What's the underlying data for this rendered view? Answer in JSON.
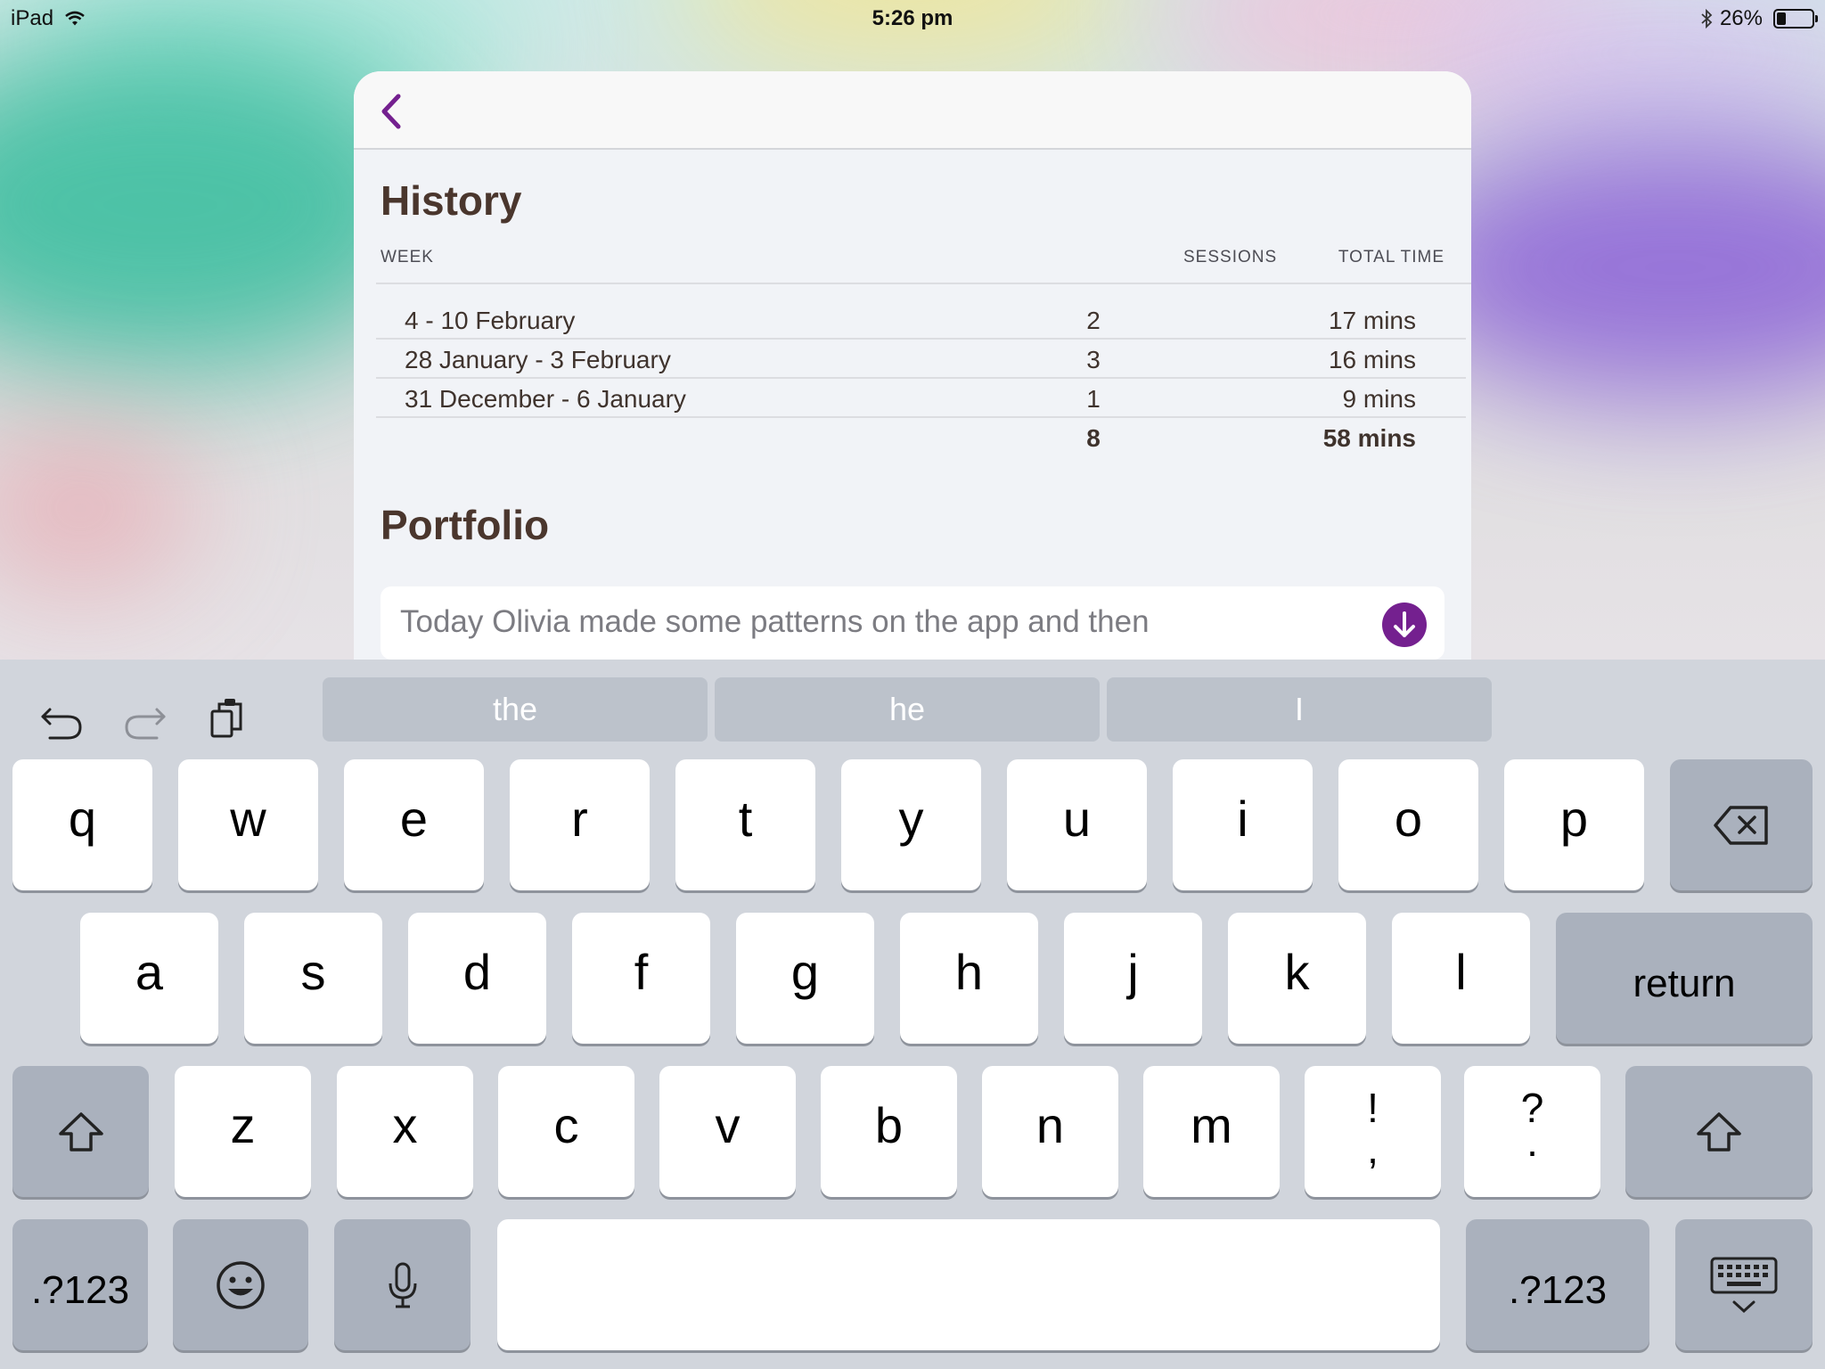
{
  "status_bar": {
    "device": "iPad",
    "time": "5:26 pm",
    "battery_percent": "26%",
    "battery_level": 0.26,
    "icons": [
      "wifi-icon",
      "bluetooth-icon",
      "battery-icon"
    ]
  },
  "colors": {
    "accent": "#74208f",
    "title": "#4a362d",
    "text": "#3f332d"
  },
  "nav": {
    "back_icon": "chevron-left-icon"
  },
  "history": {
    "title": "History",
    "columns": {
      "week": "WEEK",
      "sessions": "SESSIONS",
      "total_time": "TOTAL TIME"
    },
    "rows": [
      {
        "week": "4 - 10 February",
        "sessions": "2",
        "total_time": "17 mins"
      },
      {
        "week": "28 January - 3 February",
        "sessions": "3",
        "total_time": "16 mins"
      },
      {
        "week": "31 December - 6 January",
        "sessions": "1",
        "total_time": "9 mins"
      }
    ],
    "total": {
      "sessions": "8",
      "total_time": "58 mins"
    }
  },
  "portfolio": {
    "title": "Portfolio",
    "input_value": "Today Olivia made some patterns on the app and then",
    "send_icon": "arrow-down-circle-icon"
  },
  "keyboard": {
    "tools": [
      "undo-icon",
      "redo-icon",
      "paste-icon"
    ],
    "suggestions": [
      "the",
      "he",
      "I"
    ],
    "row1": [
      "q",
      "w",
      "e",
      "r",
      "t",
      "y",
      "u",
      "i",
      "o",
      "p"
    ],
    "row2": [
      "a",
      "s",
      "d",
      "f",
      "g",
      "h",
      "j",
      "k",
      "l"
    ],
    "row3": [
      "z",
      "x",
      "c",
      "v",
      "b",
      "n",
      "m"
    ],
    "punct1": {
      "top": "!",
      "bottom": ","
    },
    "punct2": {
      "top": "?",
      "bottom": "."
    },
    "return_label": "return",
    "numbers_label": ".?123",
    "special_icons": [
      "backspace-icon",
      "shift-icon",
      "emoji-icon",
      "microphone-icon",
      "hide-keyboard-icon"
    ]
  }
}
